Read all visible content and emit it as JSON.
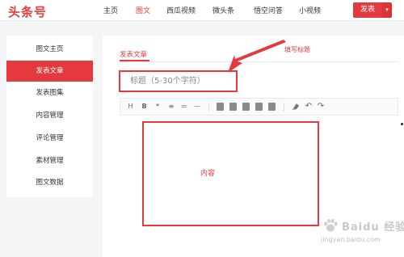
{
  "app": {
    "logo": "头条号"
  },
  "nav": {
    "items": [
      "主页",
      "图文",
      "西瓜视频",
      "微头条",
      "悟空问答",
      "小视频"
    ],
    "active_index": 1
  },
  "header": {
    "publish_label": "发表",
    "caret": "▾"
  },
  "sidebar": {
    "items": [
      {
        "label": "图文主页"
      },
      {
        "label": "发表文章"
      },
      {
        "label": "发表图集"
      },
      {
        "label": "内容管理"
      },
      {
        "label": "评论管理"
      },
      {
        "label": "素材管理"
      },
      {
        "label": "图文数据"
      }
    ],
    "active_index": 1
  },
  "editor": {
    "tab_label": "发表文章",
    "title_placeholder": "标题（5-30个字符）",
    "content_label": "内容",
    "toolbar": {
      "heading": "H",
      "bold": "B",
      "quote": "❝",
      "ordered_list": "≡",
      "unordered_list": "≔",
      "hr": "—",
      "undo": "↶",
      "redo": "↷"
    }
  },
  "annotation": {
    "label": "填写标题"
  },
  "watermark": {
    "title": "Baidu 经验",
    "url": "jingyan.baidu.com"
  },
  "colors": {
    "accent": "#e43a3d",
    "background": "#f4f5f6"
  }
}
